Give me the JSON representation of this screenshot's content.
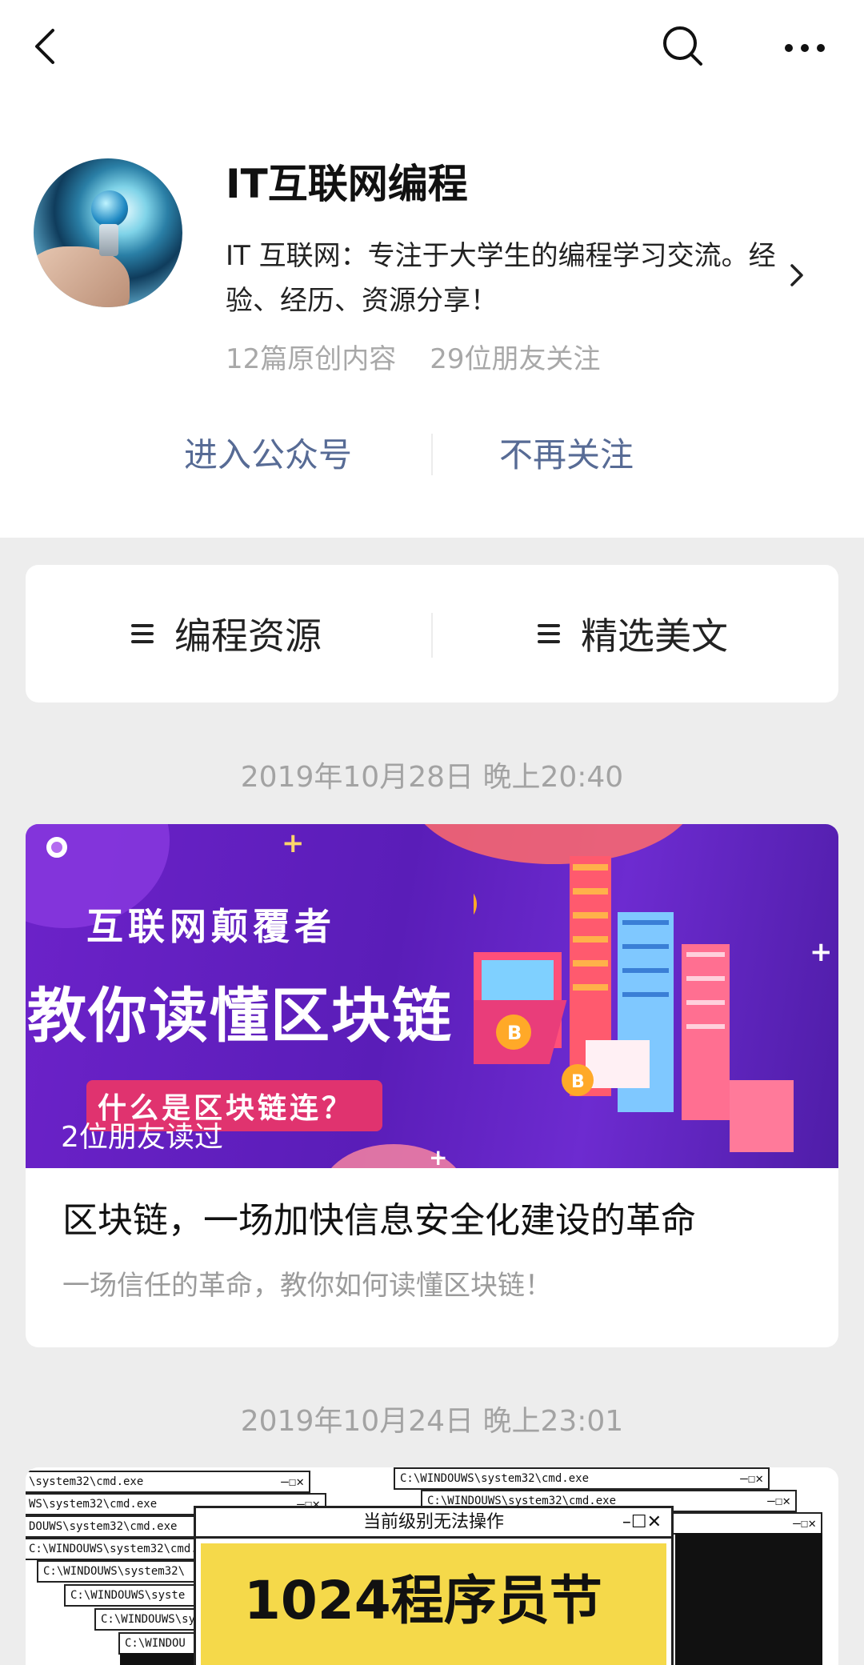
{
  "nav": {
    "back_icon": "chevron-left-icon",
    "search_icon": "search-icon",
    "more_icon": "more-icon"
  },
  "profile": {
    "name": "IT互联网编程",
    "description": "IT 互联网：专注于大学生的编程学习交流。经验、经历、资源分享！",
    "original_count": "12篇原创内容",
    "friends_following": "29位朋友关注"
  },
  "actions": {
    "enter": "进入公众号",
    "unfollow": "不再关注"
  },
  "menu": {
    "items": [
      {
        "label": "编程资源"
      },
      {
        "label": "精选美文"
      }
    ]
  },
  "posts": [
    {
      "date": "2019年10月28日 晚上20:40",
      "cover_line1": "互联网颠覆者",
      "cover_line2": "教你读懂区块链",
      "cover_pill": "什么是区块链连？",
      "read_by": "2位朋友读过",
      "title": "区块链，一场加快信息安全化建设的革命",
      "summary": "一场信任的革命，教你如何读懂区块链！"
    },
    {
      "date": "2019年10月24日 晚上23:01",
      "window_titles": [
        "\\system32\\cmd.exe",
        "WS\\system32\\cmd.exe",
        "DOUWS\\system32\\cmd.exe",
        "C:\\WINDOUWS\\system32\\cmd.",
        "C:\\WINDOUWS\\system32\\",
        "C:\\WINDOUWS\\syste",
        "C:\\WINDOUWS\\sy",
        "C:\\WINDOU",
        "C:\\WINDOUWS\\system32\\cmd.exe",
        "C:\\WINDOUWS\\system32\\cmd.exe"
      ],
      "poster_bar": "当前级别无法操作",
      "poster_text": "1024程序员节"
    }
  ],
  "colors": {
    "link": "#576b95",
    "muted": "#a8a8a8",
    "background": "#ededed"
  }
}
